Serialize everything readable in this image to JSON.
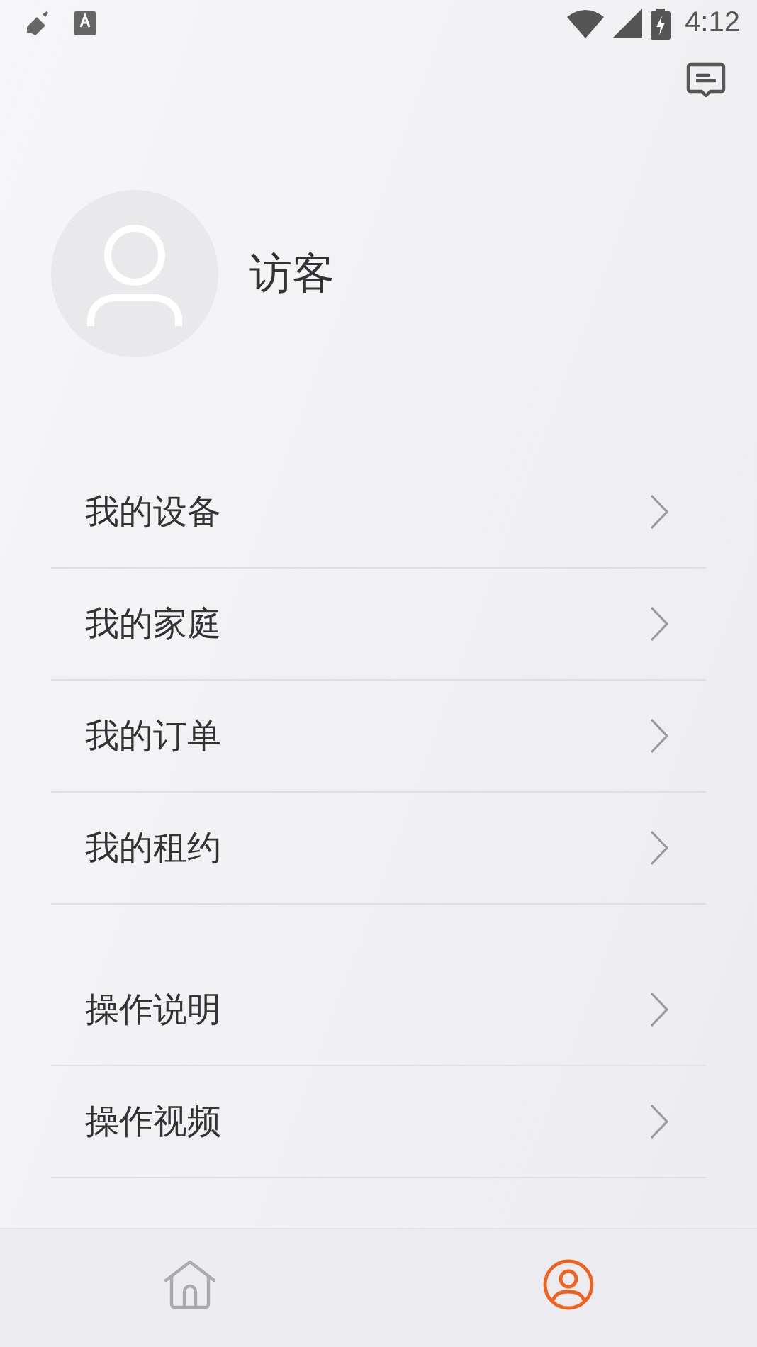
{
  "status_bar": {
    "time": "4:12"
  },
  "profile": {
    "name": "访客"
  },
  "menu_groups": [
    {
      "items": [
        {
          "label": "我的设备"
        },
        {
          "label": "我的家庭"
        },
        {
          "label": "我的订单"
        },
        {
          "label": "我的租约"
        }
      ]
    },
    {
      "items": [
        {
          "label": "操作说明"
        },
        {
          "label": "操作视频"
        }
      ]
    }
  ],
  "tabs": [
    {
      "kind": "home",
      "selected": false
    },
    {
      "kind": "profile",
      "selected": true
    }
  ]
}
